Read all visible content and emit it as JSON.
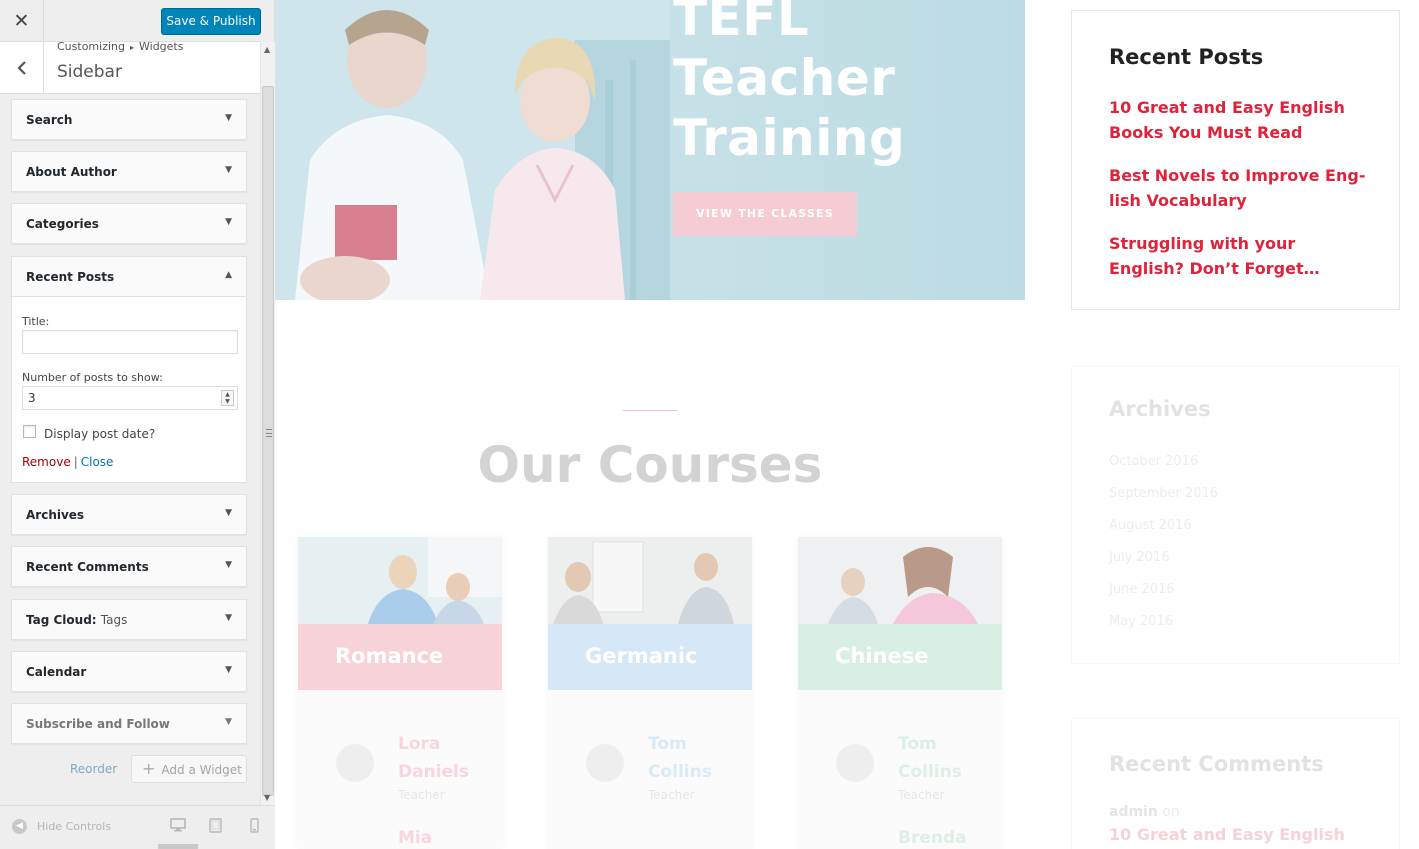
{
  "colors": {
    "publish_blue": "#0085ba",
    "link_red": "#e0233b",
    "remove_red": "#aa0000",
    "close_blue": "#0073aa",
    "romance_band": "#f7d2d8",
    "germanic_band": "#d5e8f8",
    "chinese_band": "#d8f0e4"
  },
  "panel": {
    "close_icon": "close-icon",
    "publish_label": "Save & Publish",
    "breadcrumb": [
      "Customizing",
      "Widgets"
    ],
    "section_title": "Sidebar",
    "widgets": [
      {
        "title": "Search"
      },
      {
        "title": "About Author"
      },
      {
        "title": "Categories"
      },
      {
        "title": "Recent Posts",
        "expanded": true
      },
      {
        "title": "Archives"
      },
      {
        "title": "Recent Comments"
      },
      {
        "title": "Tag Cloud:",
        "sub": "Tags"
      },
      {
        "title": "Calendar"
      },
      {
        "title": "Subscribe and Follow"
      }
    ],
    "recent_form": {
      "title_label": "Title:",
      "title_value": "",
      "count_label": "Number of posts to show:",
      "count_value": "3",
      "date_label": "Display post date?",
      "date_checked": false,
      "remove_label": "Remove",
      "separator": "|",
      "close_label": "Close"
    },
    "reorder_label": "Reorder",
    "add_widget_label": "Add a Widget",
    "footer": {
      "hide_label": "Hide Controls",
      "devices": [
        "desktop-icon",
        "tablet-icon",
        "mobile-icon"
      ],
      "active_device": "desktop"
    }
  },
  "preview": {
    "hero": {
      "title_lines": [
        "TEFL",
        "Teacher",
        "Training"
      ],
      "button_label": "VIEW THE CLASSES"
    },
    "courses_title": "Our Courses",
    "courses": [
      {
        "name": "Romance",
        "teacher_first": "Lora",
        "teacher_last": "Daniels",
        "role": "Teacher",
        "next_teacher": "Mia",
        "band_color": "#f7d2d8",
        "teacher_color": "#f8d6dc"
      },
      {
        "name": "Germanic",
        "teacher_first": "Tom",
        "teacher_last": "Collins",
        "role": "Teacher",
        "next_teacher": "",
        "band_color": "#d5e8f8",
        "teacher_color": "#d9eaf7"
      },
      {
        "name": "Chinese",
        "teacher_first": "Tom",
        "teacher_last": "Collins",
        "role": "Teacher",
        "next_teacher": "Brenda",
        "band_color": "#d8f0e4",
        "teacher_color": "#dcefe5"
      }
    ],
    "recent_posts": {
      "heading": "Recent Posts",
      "posts": [
        "10 Great and Easy English Books You Must Read",
        "Best Novels to Improve Eng-lish Vocabulary",
        "Struggling with your English? Don’t Forget…"
      ]
    },
    "archives": {
      "heading": "Archives",
      "items": [
        "October 2016",
        "September 2016",
        "August 2016",
        "July 2016",
        "June 2016",
        "May 2016"
      ]
    },
    "recent_comments": {
      "heading": "Recent Comments",
      "author": "admin",
      "on": "on",
      "link": "10 Great and Easy English"
    }
  }
}
